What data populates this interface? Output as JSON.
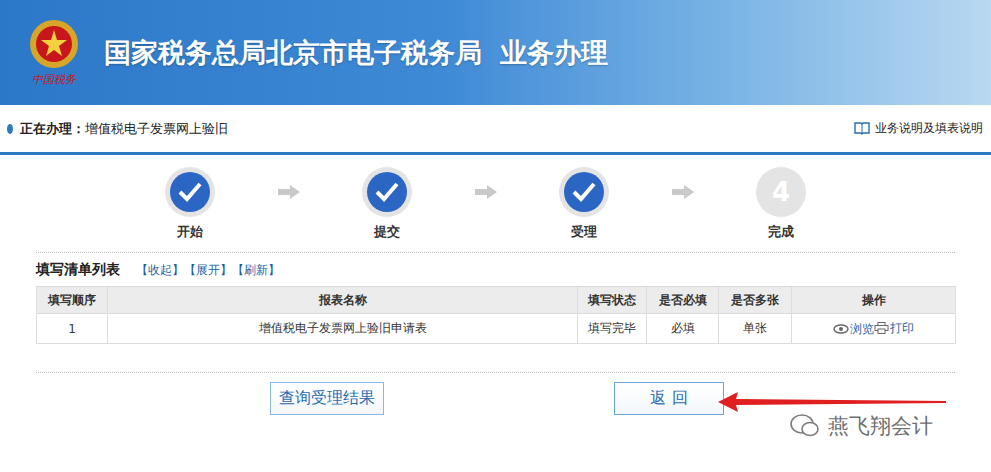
{
  "header": {
    "logo_text": "中国税务",
    "title": "国家税务总局北京市电子税务局",
    "subtitle": "业务办理"
  },
  "breadcrumb": {
    "label": "正在办理：",
    "value": "增值税电子发票网上验旧",
    "help": "业务说明及填表说明"
  },
  "steps": [
    {
      "label": "开始",
      "done": true
    },
    {
      "label": "提交",
      "done": true
    },
    {
      "label": "受理",
      "done": true
    },
    {
      "label": "完成",
      "done": false,
      "number": "4"
    }
  ],
  "list": {
    "title": "填写清单列表",
    "links": [
      "【收起】",
      "【展开】",
      "【刷新】"
    ]
  },
  "table": {
    "columns": [
      "填写顺序",
      "报表名称",
      "填写状态",
      "是否必填",
      "是否多张",
      "操作"
    ],
    "rows": [
      {
        "order": "1",
        "name": "增值税电子发票网上验旧申请表",
        "status": "填写完毕",
        "required": "必填",
        "multi": "单张",
        "actions": [
          "浏览",
          "打印"
        ]
      }
    ]
  },
  "buttons": [
    {
      "label": "查询受理结果",
      "highlighted": false
    },
    {
      "label": "返 回",
      "highlighted": true
    }
  ],
  "watermark": "燕飞翔会计"
}
